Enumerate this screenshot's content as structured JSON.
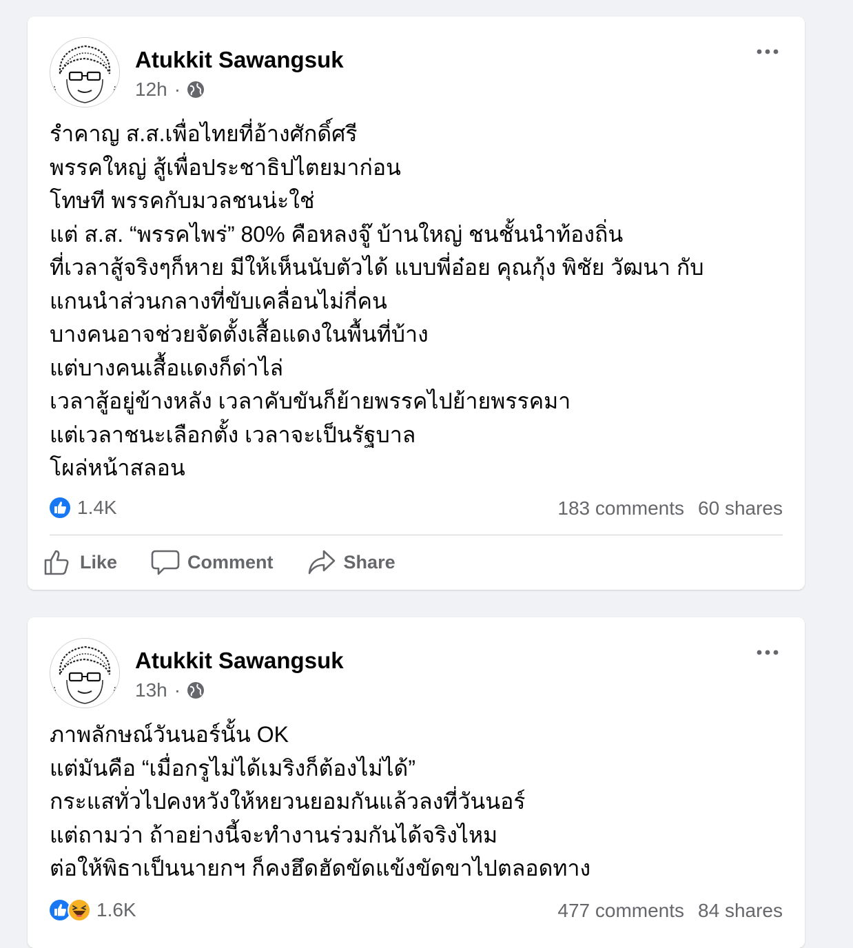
{
  "posts": [
    {
      "author": "Atukkit Sawangsuk",
      "time": "12h",
      "separator": "·",
      "privacy_icon": "globe-icon",
      "lines": [
        "รำคาญ ส.ส.เพื่อไทยที่อ้างศักดิ์ศรี",
        "พรรคใหญ่ สู้เพื่อประชาธิปไตยมาก่อน",
        "โทษที พรรคกับมวลชนน่ะใช่",
        "แต่ ส.ส. “พรรคไพร่” 80% คือหลงจู๊ บ้านใหญ่ ชนชั้นนำท้องถิ่น",
        "ที่เวลาสู้จริงๆก็หาย มีให้เห็นนับตัวได้ แบบพี่อ๋อย คุณกุ้ง พิชัย วัฒนา กับ",
        "แกนนำส่วนกลางที่ขับเคลื่อนไม่กี่คน",
        "บางคนอาจช่วยจัดตั้งเสื้อแดงในพื้นที่บ้าง",
        "แต่บางคนเสื้อแดงก็ด่าไล่",
        "เวลาสู้อยู่ข้างหลัง เวลาคับขันก็ย้ายพรรคไปย้ายพรรคมา",
        "แต่เวลาชนะเลือกตั้ง เวลาจะเป็นรัฐบาล",
        "โผล่หน้าสลอน"
      ],
      "reactions_count": "1.4K",
      "reaction_icons": [
        "like-icon"
      ],
      "comments": "183 comments",
      "shares": "60 shares",
      "actions": {
        "like": "Like",
        "comment": "Comment",
        "share": "Share"
      }
    },
    {
      "author": "Atukkit Sawangsuk",
      "time": "13h",
      "separator": "·",
      "privacy_icon": "globe-icon",
      "lines": [
        "ภาพลักษณ์วันนอร์นั้น OK",
        "แต่มันคือ “เมื่อกรูไม่ได้เมริงก็ต้องไม่ได้”",
        "กระแสทั่วไปคงหวังให้หยวนยอมกันแล้วลงที่วันนอร์",
        "แต่ถามว่า ถ้าอย่างนี้จะทำงานร่วมกันได้จริงไหม",
        "ต่อให้พิธาเป็นนายกฯ ก็คงฮึดฮัดขัดแข้งขัดขาไปตลอดทาง"
      ],
      "reactions_count": "1.6K",
      "reaction_icons": [
        "like-icon",
        "haha-icon"
      ],
      "comments": "477 comments",
      "shares": "84 shares"
    }
  ],
  "colors": {
    "background": "#f0f2f5",
    "card": "#ffffff",
    "text": "#050505",
    "secondary_text": "#65676b",
    "like_blue": "#1877f2",
    "haha_yellow": "#f7b125"
  }
}
